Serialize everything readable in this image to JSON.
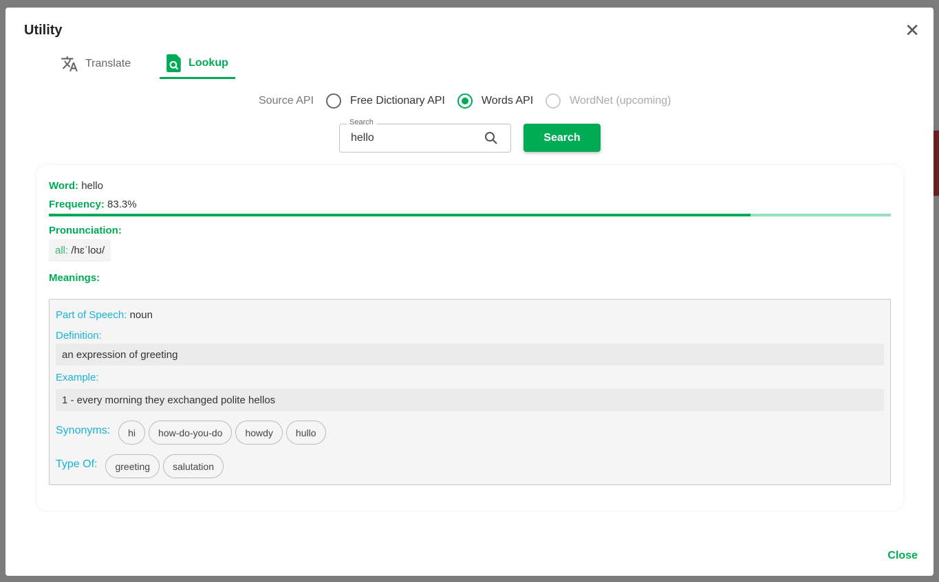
{
  "dialog": {
    "title": "Utility",
    "close_label": "Close"
  },
  "tabs": [
    {
      "label": "Translate",
      "icon": "translate-icon",
      "active": false
    },
    {
      "label": "Lookup",
      "icon": "find-in-page-icon",
      "active": true
    }
  ],
  "source_api": {
    "label": "Source API",
    "options": [
      {
        "label": "Free Dictionary API",
        "selected": false,
        "disabled": false
      },
      {
        "label": "Words API",
        "selected": true,
        "disabled": false
      },
      {
        "label": "WordNet (upcoming)",
        "selected": false,
        "disabled": true
      }
    ]
  },
  "search": {
    "label": "Search",
    "value": "hello",
    "button": "Search"
  },
  "result": {
    "word_label": "Word:",
    "word": "hello",
    "frequency_label": "Frequency:",
    "frequency": "83.3%",
    "frequency_value": 83.3,
    "pronunciation_label": "Pronunciation:",
    "pron_key": "all:",
    "pron_value": "/hɛˈloʊ/",
    "meanings_label": "Meanings:",
    "meaning": {
      "pos_label": "Part of Speech:",
      "pos": "noun",
      "definition_label": "Definition:",
      "definition": "an expression of greeting",
      "example_label": "Example:",
      "example": "1 - every morning they exchanged polite hellos",
      "synonyms_label": "Synonyms:",
      "synonyms": [
        "hi",
        "how-do-you-do",
        "howdy",
        "hullo"
      ],
      "typeof_label": "Type Of:",
      "typeof": [
        "greeting",
        "salutation"
      ]
    }
  },
  "colors": {
    "accent": "#00ab55",
    "secondary": "#17b3d7"
  }
}
